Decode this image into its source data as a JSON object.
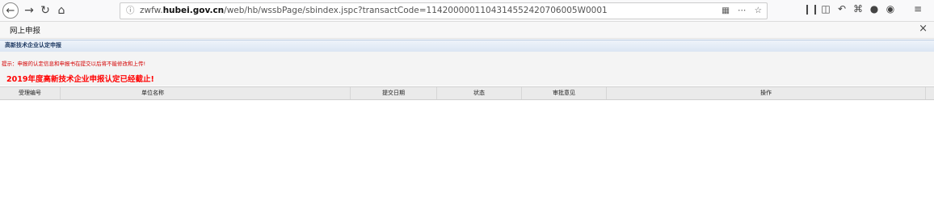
{
  "browser": {
    "url_prefix": "zwfw.",
    "url_domain": "hubei.gov.cn",
    "url_rest": "/web/hb/wssbPage/sbindex.jspc?transactCode=114200000110431455242070600 5W0001",
    "back_icon": "back-arrow-icon",
    "forward_icon": "forward-arrow-icon",
    "reload_icon": "reload-icon",
    "home_icon": "home-icon"
  },
  "tab": {
    "label": "网上申报",
    "close": "×"
  },
  "section": {
    "title": "高新技术企业认定申报"
  },
  "notice": {
    "text": "提示：申报的认定信息和申报书在提交以后将不能修改和上传!",
    "deadline": "2019年度高新技术企业申报认定已经截止!"
  },
  "table": {
    "columns": [
      "受理编号",
      "单位名称",
      "提交日期",
      "状态",
      "审批意见",
      "操作"
    ]
  },
  "colors": {
    "alert_red": "#ff0000",
    "header_blue": "#1f3a63"
  }
}
